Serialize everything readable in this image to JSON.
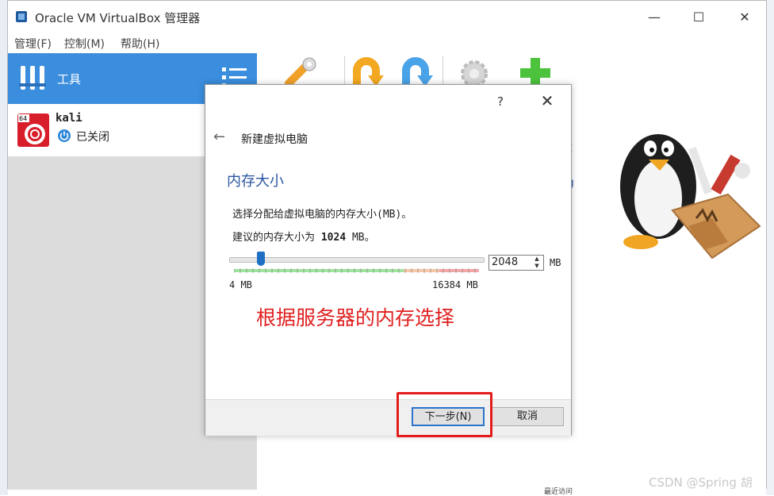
{
  "window": {
    "title": "Oracle VM VirtualBox 管理器",
    "minimize": "—",
    "maximize": "☐",
    "close": "✕"
  },
  "menu": [
    {
      "label": "管理(F)"
    },
    {
      "label": "控制(M)"
    },
    {
      "label": "帮助(H)"
    }
  ],
  "sidebar": {
    "tools_label": "工具",
    "vm": {
      "name": "kali",
      "state": "已关闭",
      "arch_badge": "64"
    }
  },
  "content": {
    "fragment_1": "些",
    "fragment_2": "rg",
    "recent": "最近访问"
  },
  "dialog": {
    "help": "?",
    "close": "✕",
    "back": "←",
    "title": "新建虚拟电脑",
    "section_title": "内存大小",
    "description": "选择分配给虚拟电脑的内存大小(MB)。",
    "recommend_prefix": "建议的内存大小为",
    "recommend_value": "1024",
    "recommend_suffix": " MB。",
    "memory_value": "2048",
    "unit": "MB",
    "min_label": "4 MB",
    "max_label": "16384 MB",
    "slider_fraction": 0.125,
    "next_button": "下一步(N)",
    "cancel_button": "取消"
  },
  "annotation": "根据服务器的内存选择",
  "watermark": "CSDN @Spring  胡",
  "colors": {
    "accent_blue": "#3b8ddd",
    "annotation_red": "#e02020",
    "scale_green": "#9fe39f",
    "scale_orange": "#f6c8a8",
    "scale_red": "#f2a6a6"
  },
  "icons": [
    "virtualbox-icon",
    "tools-icon",
    "list-icon",
    "power-icon",
    "settings-wrench-icon",
    "discard-arrow-icon",
    "start-arrow-icon",
    "gear-icon",
    "add-icon",
    "tux-toolbox-illustration"
  ]
}
